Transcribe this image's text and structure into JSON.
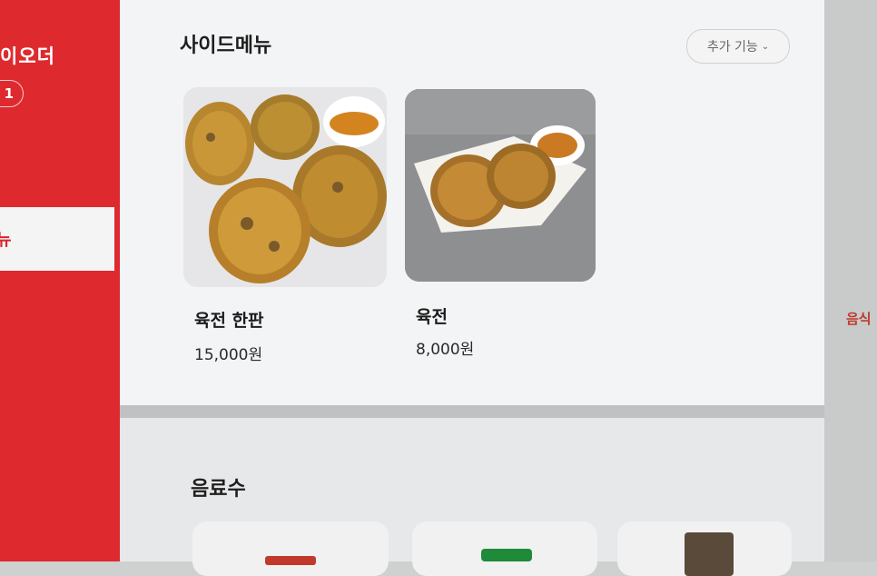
{
  "sidebar": {
    "brand": "이오더",
    "table_number": "1",
    "active_nav_label": "뉴"
  },
  "header": {
    "section_side": "사이드메뉴",
    "more_button": "추가 기능",
    "more_icon": "chevron-down-icon"
  },
  "side_menu": [
    {
      "name": "육전 한판",
      "price": "15,000원"
    },
    {
      "name": "육전",
      "price": "8,000원"
    }
  ],
  "drinks": {
    "section_title": "음료수"
  },
  "edge_text": "음식"
}
